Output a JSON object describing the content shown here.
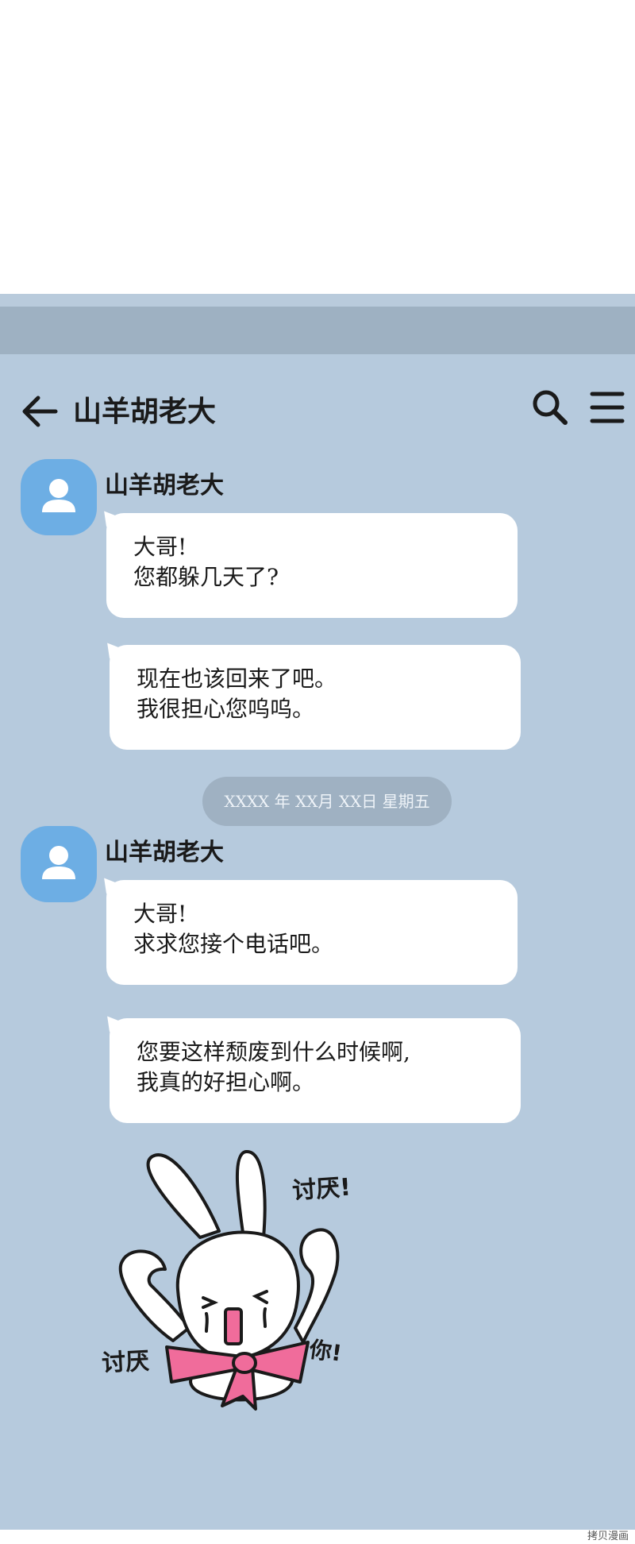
{
  "header": {
    "title": "山羊胡老大",
    "back_icon": "arrow-left-icon",
    "search_icon": "search-icon",
    "menu_icon": "hamburger-menu-icon"
  },
  "colors": {
    "chat_background": "#b6cadd",
    "status_bar": "#9eb1c2",
    "avatar": "#6daee4",
    "bubble": "#ffffff",
    "date_pill": "#9fb1c2",
    "sticker_bow": "#f06c9b"
  },
  "messages": [
    {
      "sender": "山羊胡老大",
      "lines": [
        "大哥!",
        "您都躲几天了?"
      ]
    },
    {
      "lines": [
        "现在也该回来了吧。",
        "我很担心您呜呜。"
      ]
    },
    {
      "sender": "山羊胡老大",
      "lines": [
        "大哥!",
        "求求您接个电话吧。"
      ]
    },
    {
      "lines": [
        "您要这样颓废到什么时候啊,",
        "我真的好担心啊。"
      ]
    }
  ],
  "date_separator": "XXXX 年 XX月 XX日 星期五",
  "sticker": {
    "icon": "crying-rabbit-sticker",
    "text_top": "讨厌!",
    "text_left": "讨厌",
    "text_right": "你!"
  },
  "watermark": "拷贝漫画"
}
